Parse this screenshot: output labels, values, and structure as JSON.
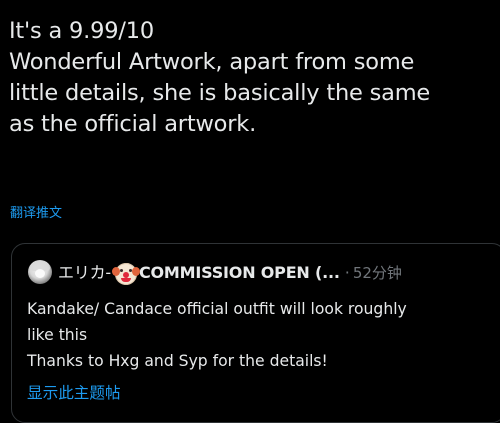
{
  "tweet": {
    "lines": [
      "It's a 9.99/10",
      "Wonderful Artwork, apart from some",
      "little details, she is basically the same",
      "as the official artwork."
    ],
    "translate_label": "翻译推文"
  },
  "quote": {
    "avatar_icon": "avatar-image",
    "name_jp": "エリカ-",
    "emoji_icon": "clown-face-icon",
    "commission_text": "COMMISSION OPEN (...",
    "separator": "·",
    "timestamp": "52分钟",
    "body_lines": [
      "Kandake/ Candace official outfit will look roughly",
      "like this",
      "Thanks to Hxg and Syp  for the details!"
    ],
    "show_thread_label": "显示此主题帖"
  },
  "colors": {
    "background": "#000000",
    "text": "#e7e9ea",
    "secondary": "#71767b",
    "link": "#1d9bf0",
    "border": "#2f3336"
  }
}
